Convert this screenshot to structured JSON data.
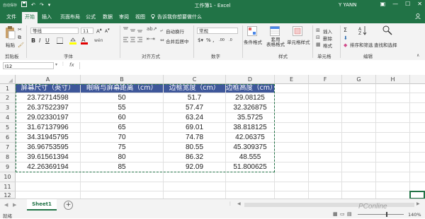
{
  "titlebar": {
    "autosave": "自动保存",
    "title": "工作簿1 - Excel",
    "user": "Y YANN",
    "minimize": "—",
    "maximize": "☐",
    "close": "✕"
  },
  "tabs": {
    "items": [
      "文件",
      "开始",
      "插入",
      "页面布局",
      "公式",
      "数据",
      "审阅",
      "视图"
    ],
    "active": "开始",
    "tellme": "告诉我你想要做什么"
  },
  "ribbon": {
    "clipboard": {
      "paste": "粘贴",
      "label": "剪贴板"
    },
    "font": {
      "name": "等线",
      "size": "11",
      "label": "字体",
      "wen": "wén"
    },
    "alignment": {
      "wrap": "自动换行",
      "merge": "合并后居中",
      "label": "对齐方式"
    },
    "number": {
      "format": "常规",
      "label": "数字",
      "percent": "%",
      "comma": ",",
      "dec_inc": ".00",
      "dec_dec": ".0"
    },
    "styles": {
      "conditional": "条件格式",
      "table": "套用\n表格格式",
      "cell": "单元格样式",
      "label": "样式"
    },
    "cells": {
      "insert": "插入",
      "delete": "删除",
      "format": "格式",
      "label": "单元格"
    },
    "editing": {
      "sort": "排序和筛选",
      "find": "查找和选择",
      "label": "编辑",
      "sum": "Σ"
    }
  },
  "formula_bar": {
    "name_box": "I12",
    "fx": "fx",
    "content": ""
  },
  "sheet": {
    "columns": [
      "A",
      "B",
      "C",
      "D",
      "E",
      "F",
      "G",
      "H"
    ],
    "rows": [
      "1",
      "2",
      "3",
      "4",
      "5",
      "6",
      "7",
      "8",
      "9",
      "10",
      "11",
      "12"
    ],
    "headers": [
      "屏幕尺寸（英寸）",
      "眼睛与屏幕距离（cm）",
      "边框宽度（cm）",
      "边框高度（cm）"
    ],
    "data": [
      [
        "23.72714598",
        "50",
        "51.7",
        "29.08125"
      ],
      [
        "26.37522397",
        "55",
        "57.47",
        "32.326875"
      ],
      [
        "29.02330197",
        "60",
        "63.24",
        "35.5725"
      ],
      [
        "31.67137996",
        "65",
        "69.01",
        "38.818125"
      ],
      [
        "34.31945795",
        "70",
        "74.78",
        "42.06375"
      ],
      [
        "36.96753595",
        "75",
        "80.55",
        "45.309375"
      ],
      [
        "39.61561394",
        "80",
        "86.32",
        "48.555"
      ],
      [
        "42.26369194",
        "85",
        "92.09",
        "51.800625"
      ]
    ]
  },
  "sheet_tabs": {
    "active": "Sheet1",
    "add": "+"
  },
  "statusbar": {
    "status": "就绪",
    "zoom": "140%",
    "watermark": "PConline"
  },
  "colors": {
    "excel_green": "#217346",
    "header_fill": "#3e579a",
    "marching_ants": "#217346"
  }
}
